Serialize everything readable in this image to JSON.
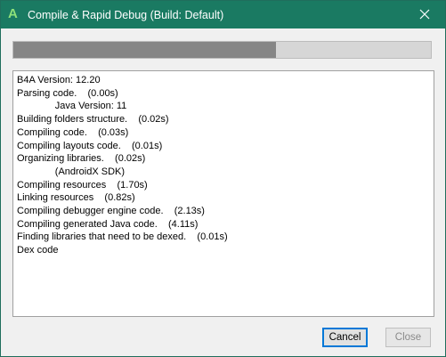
{
  "window": {
    "title": "Compile & Rapid Debug (Build: Default)",
    "app_icon_glyph": "A",
    "accent_color": "#1a7a62"
  },
  "progress": {
    "fraction": 0.63
  },
  "log": {
    "lines": [
      "B4A Version: 12.20",
      "Parsing code.    (0.00s)",
      "              Java Version: 11",
      "Building folders structure.    (0.02s)",
      "Compiling code.    (0.03s)",
      "Compiling layouts code.    (0.01s)",
      "Organizing libraries.    (0.02s)",
      "              (AndroidX SDK)",
      "Compiling resources    (1.70s)",
      "Linking resources    (0.82s)",
      "Compiling debugger engine code.    (2.13s)",
      "Compiling generated Java code.    (4.11s)",
      "Finding libraries that need to be dexed.    (0.01s)",
      "Dex code"
    ]
  },
  "buttons": {
    "cancel_label": "Cancel",
    "close_label": "Close"
  },
  "icons": {
    "app": "b4a-logo-icon",
    "close": "close-icon"
  }
}
